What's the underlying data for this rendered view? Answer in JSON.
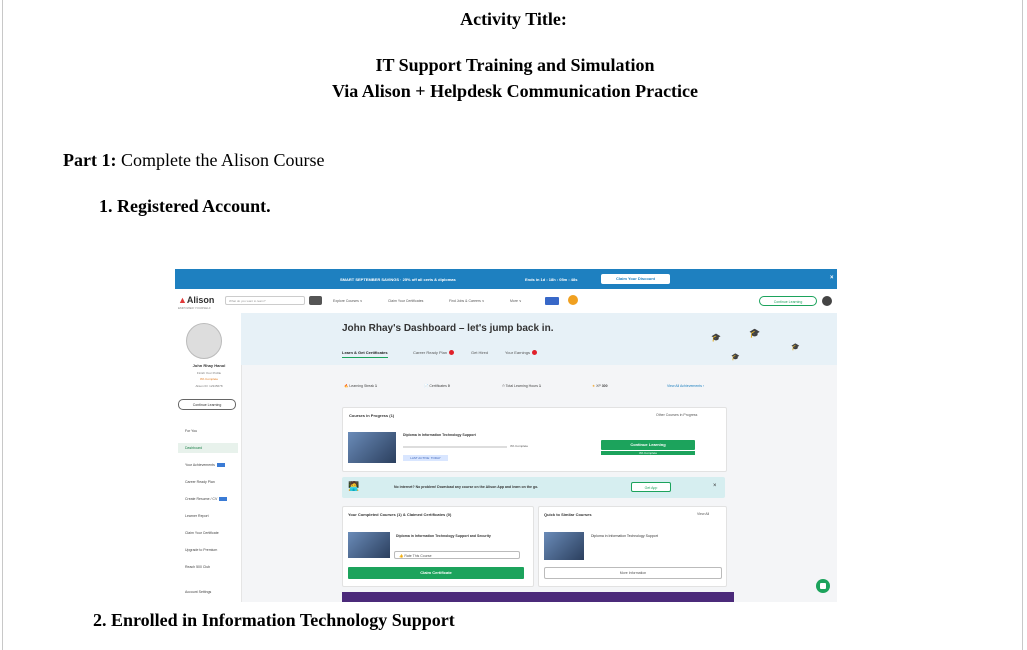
{
  "document": {
    "activity_label": "Activity Title:",
    "title_line1": "IT Support Training and Simulation",
    "title_line2": "Via Alison + Helpdesk Communication Practice",
    "part_label": "Part 1:",
    "part_text": " Complete the Alison Course",
    "step1": "1. Registered Account.",
    "step2": "2. Enrolled in Information Technology Support"
  },
  "screenshot": {
    "promo": {
      "text": "SMART SEPTEMBER SAVINGS · 25% off all certs & diplomas",
      "timer": "Ends in 1d : 18h : 05m : 48s",
      "button": "Claim Your Discount",
      "close": "×"
    },
    "nav": {
      "logo": "Alison",
      "logo_sub": "EMPOWER YOURSELF",
      "search_placeholder": "What do you want to learn?",
      "items": [
        "Explore Courses ∨",
        "Claim Your Certificates",
        "Find Jobs & Careers ∨",
        "More ∨"
      ],
      "continue_button": "Continue Learning"
    },
    "sidebar": {
      "user_name": "John Rhay Hanol",
      "profile_link": "Finish Your Profile",
      "profile_pct": "0% Complete",
      "learner_id": "Alison ID: 12345678",
      "continue_button": "Continue Learning",
      "items": [
        {
          "label": "For You",
          "active": false,
          "badge": false
        },
        {
          "label": "Dashboard",
          "active": true,
          "badge": false
        },
        {
          "label": "Your Achievements",
          "active": false,
          "badge": true
        },
        {
          "label": "Career Ready Plan",
          "active": false,
          "badge": false
        },
        {
          "label": "Create Resume / CV",
          "active": false,
          "badge": true
        },
        {
          "label": "Learner Report",
          "active": false,
          "badge": false
        },
        {
          "label": "Claim Your Certificate",
          "active": false,
          "badge": false
        },
        {
          "label": "Upgrade to Premium",
          "active": false,
          "badge": false
        },
        {
          "label": "Reach 500 Club",
          "active": false,
          "badge": false
        },
        {
          "label": "Account Settings",
          "active": false,
          "badge": false
        }
      ]
    },
    "header": {
      "title": "John Rhay's Dashboard – let's jump back in.",
      "tabs": [
        "Learn & Get Certificates",
        "Career Ready Plan",
        "Get Hired",
        "Your Earnings"
      ]
    },
    "stats": {
      "learning_streak_label": "Learning Streak",
      "learning_streak_value": "1",
      "certificates_label": "Certificates",
      "certificates_value": "0",
      "hours_label": "Total Learning Hours",
      "hours_value": "1",
      "xp_label": "XP",
      "xp_value": "300",
      "achievements_link": "View All Achievements ›"
    },
    "in_progress": {
      "title": "Courses in Progress (1)",
      "link": "Other Courses in Progress",
      "course": "Diploma in Information Technology Support",
      "pct": "3% Complete",
      "tag": "LAST ACTIVE: TODAY",
      "button": "Continue Learning",
      "sub": "3% Complete"
    },
    "banner": {
      "text": "No internet? No problem! Download any course on the Alison App and learn on the go.",
      "button": "Get App",
      "close": "×"
    },
    "completed": {
      "title": "Your Completed Courses (1) & Claimed Certificates (0)",
      "course": "Diploma in Information Technology Support and Security",
      "rate": "Rate This Course",
      "button": "Claim Certificate"
    },
    "similar": {
      "title": "Quick to Similar Courses",
      "link": "View All",
      "course": "Diploma in Information Technology Support",
      "button": "More Information"
    }
  }
}
